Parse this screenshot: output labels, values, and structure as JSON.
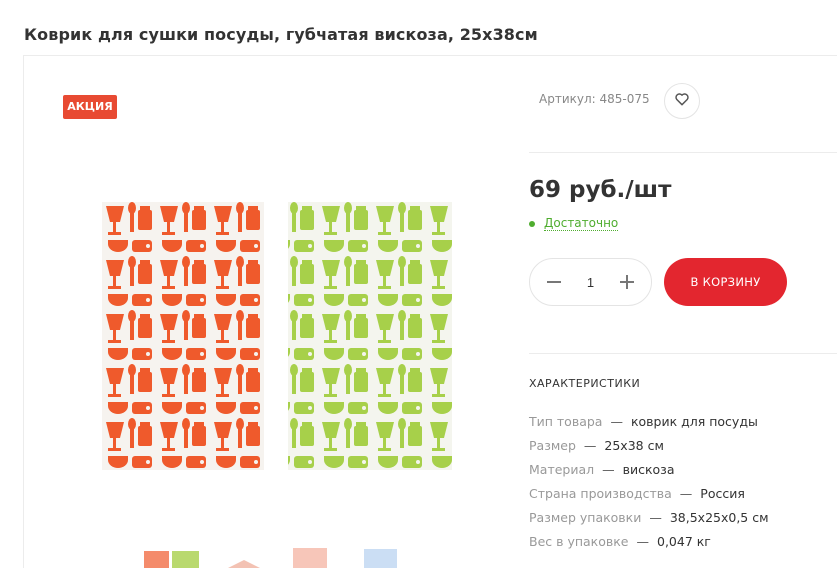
{
  "product": {
    "title": "Коврик для сушки посуды, губчатая вискоза, 25х38см",
    "badge": "АКЦИЯ",
    "article": "Артикул: 485-075",
    "price": "69 руб./шт",
    "stock": "Достаточно",
    "quantity": "1",
    "cart_label": "В КОРЗИНУ"
  },
  "specs": {
    "title": "ХАРАКТЕРИСТИКИ",
    "dash": "—",
    "rows": [
      {
        "label": "Тип товара",
        "value": "коврик для посуды"
      },
      {
        "label": "Размер",
        "value": "25х38 см"
      },
      {
        "label": "Материал",
        "value": "вискоза"
      },
      {
        "label": "Страна производства",
        "value": "Россия"
      },
      {
        "label": "Размер упаковки",
        "value": "38,5х25х0,5 см"
      },
      {
        "label": "Вес в упаковке",
        "value": "0,047 кг"
      }
    ]
  },
  "icons": {
    "favorite": "heart-icon",
    "minus": "minus-icon",
    "plus": "plus-icon"
  },
  "colors": {
    "badge": "#e84a32",
    "cart_button": "#e3262f",
    "stock": "#4fad2f",
    "mat_orange": "#ef5a2c",
    "mat_green": "#a7d04a"
  }
}
